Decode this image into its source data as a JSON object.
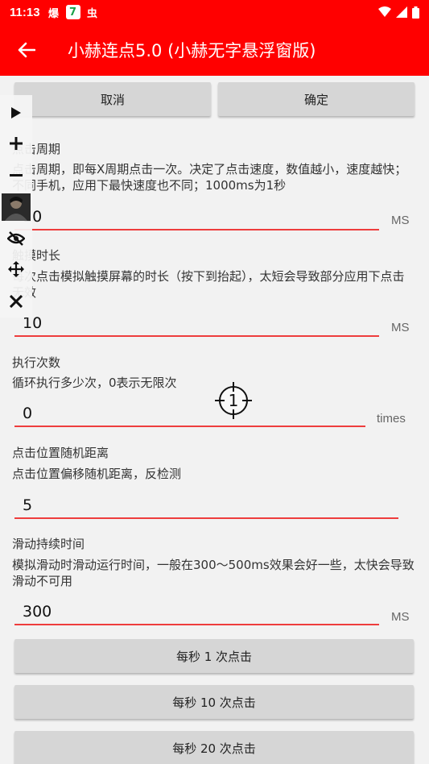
{
  "status": {
    "time": "11:13",
    "notif1": "爆",
    "notif2": "7",
    "notif3": "虫"
  },
  "appbar": {
    "title": "小赫连点5.0 (小赫无字悬浮窗版)"
  },
  "top_buttons": {
    "cancel": "取消",
    "confirm": "确定"
  },
  "fields": [
    {
      "label": "点击周期",
      "desc": "点击周期，即每X周期点击一次。决定了点击速度，数值越小，速度越快；不同手机，应用下最快速度也不同；1000ms为1秒",
      "value": "10",
      "unit": "MS"
    },
    {
      "label": "触摸时长",
      "desc": "每次点击模拟触摸屏幕的时长（按下到抬起），太短会导致部分应用下点击无效",
      "value": "10",
      "unit": "MS"
    },
    {
      "label": "执行次数",
      "desc": "循环执行多少次，0表示无限次",
      "value": "0",
      "unit": "times"
    },
    {
      "label": "点击位置随机距离",
      "desc": "点击位置偏移随机距离，反检测",
      "value": "5",
      "unit": ""
    },
    {
      "label": "滑动持续时间",
      "desc": "模拟滑动时滑动运行时间，一般在300～500ms效果会好一些，太快会导致滑动不可用",
      "value": "300",
      "unit": "MS"
    }
  ],
  "presets": [
    "每秒 1 次点击",
    "每秒 10 次点击",
    "每秒 20 次点击"
  ],
  "crosshair": {
    "label": "1"
  },
  "icons": {
    "play": "play-icon",
    "add": "plus-icon",
    "remove": "minus-icon",
    "hide": "eye-off-icon",
    "move": "move-icon",
    "close": "close-icon"
  },
  "colors": {
    "accent": "#ff0000",
    "underline": "#ee3d3d"
  }
}
